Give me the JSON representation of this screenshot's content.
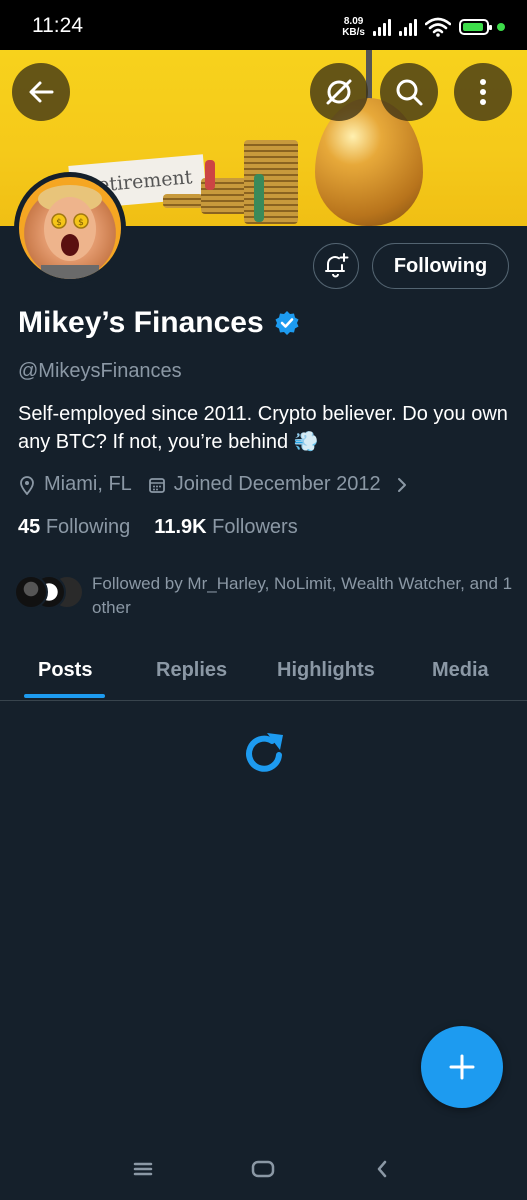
{
  "status_bar": {
    "time": "11:24",
    "net_speed_value": "8.09",
    "net_speed_unit": "KB/s",
    "battery_color": "#3ddc4a"
  },
  "banner": {
    "card_text": "etirement",
    "back_icon": "arrow-left-icon",
    "grok_icon": "slashed-circle-icon",
    "search_icon": "search-icon",
    "more_icon": "more-vertical-icon"
  },
  "profile": {
    "display_name": "Mikey’s Finances",
    "verified_color": "#1d9bf0",
    "handle": "@MikeysFinances",
    "bio": "Self-employed since 2011. Crypto believer. Do you own any BTC? If not, you’re behind 💨",
    "location": "Miami, FL",
    "joined": "Joined December 2012",
    "following_count": "45",
    "following_label": "Following",
    "followers_count": "11.9K",
    "followers_label": "Followers",
    "followed_by": "Followed by Mr_Harley, NoLimit, Wealth Watcher, and 1 other",
    "following_button": "Following",
    "bell_icon": "bell-plus-icon"
  },
  "tabs": [
    {
      "label": "Posts",
      "active": true
    },
    {
      "label": "Replies",
      "active": false
    },
    {
      "label": "Highlights",
      "active": false
    },
    {
      "label": "Media",
      "active": false
    }
  ],
  "accent_color": "#1d9bf0",
  "fab_icon": "plus-icon",
  "nav": {
    "recents_icon": "menu-lines-icon",
    "home_icon": "rounded-square-icon",
    "back_icon": "chevron-left-icon"
  }
}
